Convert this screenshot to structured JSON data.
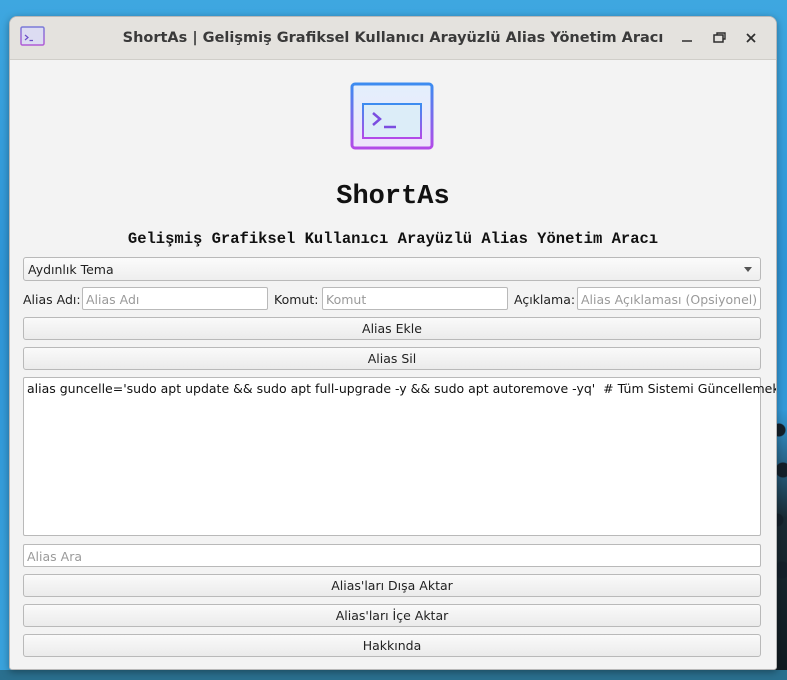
{
  "window": {
    "title": "ShortAs | Gelişmiş Grafiksel Kullanıcı Arayüzlü Alias Yönetim Aracı",
    "icon": "terminal-icon",
    "controls": [
      "minimize-icon",
      "maximize-icon",
      "close-icon"
    ]
  },
  "header": {
    "app_name": "ShortAs",
    "subtitle": "Gelişmiş Grafiksel Kullanıcı Arayüzlü Alias Yönetim Aracı",
    "logo": "terminal-window-logo"
  },
  "theme": {
    "selected": "Aydınlık Tema"
  },
  "form": {
    "alias_label": "Alias Adı:",
    "alias_placeholder": "Alias Adı",
    "command_label": "Komut:",
    "command_placeholder": "Komut",
    "description_label": "Açıklama:",
    "description_placeholder": "Alias Açıklaması (Opsiyonel)"
  },
  "buttons": {
    "add": "Alias Ekle",
    "remove": "Alias Sil",
    "export": "Alias'ları Dışa Aktar",
    "import": "Alias'ları İçe Aktar",
    "about": "Hakkında"
  },
  "alias_list": [
    "alias guncelle='sudo apt update && sudo apt full-upgrade -y && sudo apt autoremove -yq'  # Tüm Sistemi Güncellemek İçin"
  ],
  "search": {
    "placeholder": "Alias Ara"
  },
  "colors": {
    "logo_gradient_start": "#3c8cf0",
    "logo_gradient_end": "#b34ae8"
  }
}
